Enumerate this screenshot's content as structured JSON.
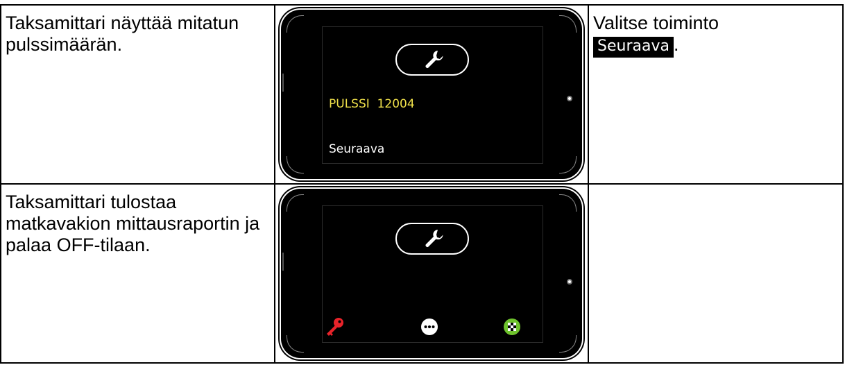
{
  "rows": [
    {
      "description": "Taksamittari näyttää mitatun pulssimäärän.",
      "screen": {
        "pulse_label": "PULSSI",
        "pulse_value": "12004",
        "next_label": "Seuraava"
      },
      "action_prefix": "Valitse toiminto",
      "action_highlight": "Seuraava",
      "action_suffix": "."
    },
    {
      "description": "Taksamittari tulostaa matkavakion mittausraportin ja palaa OFF-tilaan.",
      "screen": {
        "icons": [
          "key-icon",
          "more-icon",
          "finish-flag-icon"
        ]
      },
      "action_prefix": ""
    }
  ],
  "colors": {
    "pulse_text": "#f0e14a",
    "key_icon": "#e8232a",
    "finish_icon": "#6ec22d",
    "device_bg": "#000000"
  }
}
